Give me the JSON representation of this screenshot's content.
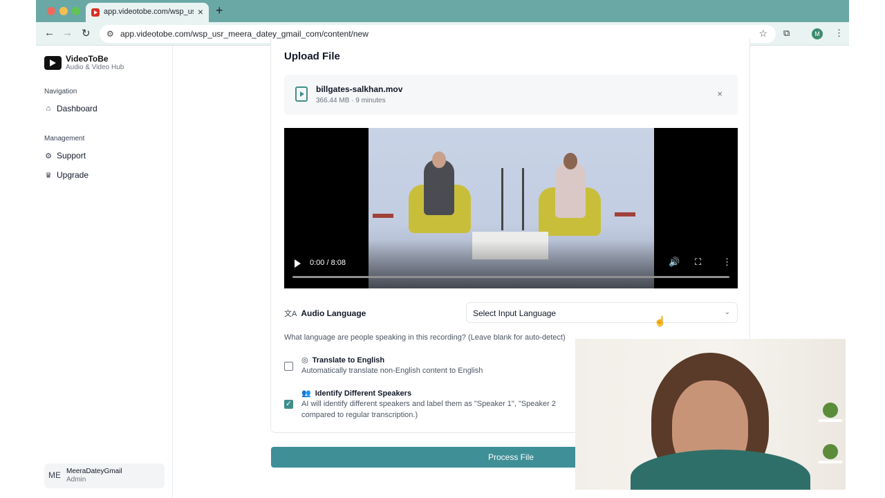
{
  "browser": {
    "tab_title": "app.videotobe.com/wsp_usr_",
    "tab_close": "×",
    "new_tab": "+",
    "url": "app.videotobe.com/wsp_usr_meera_datey_gmail_com/content/new",
    "profile_initial": "M"
  },
  "sidebar": {
    "brand": "VideoToBe",
    "tagline": "Audio & Video Hub",
    "sections": [
      {
        "title": "Navigation",
        "items": [
          {
            "label": "Dashboard",
            "icon": "home-icon"
          }
        ]
      },
      {
        "title": "Management",
        "items": [
          {
            "label": "Support",
            "icon": "gear-icon"
          },
          {
            "label": "Upgrade",
            "icon": "crown-icon"
          }
        ]
      }
    ],
    "user": {
      "initials": "ME",
      "name": "MeeraDateyGmail",
      "role": "Admin"
    }
  },
  "main": {
    "title": "Upload File",
    "file": {
      "name": "billgates-salkhan.mov",
      "meta": "366.44 MB  ·  9 minutes",
      "close": "×"
    },
    "video": {
      "timecode": "0:00 / 8:08",
      "progress": 0
    },
    "audio_language": {
      "label": "Audio Language",
      "select_value": "Select Input Language",
      "help": "What language are people speaking in this recording? (Leave blank for auto-detect)"
    },
    "options": [
      {
        "title": "Translate to English",
        "desc": "Automatically translate non-English content to English",
        "checked": false,
        "icon": "globe-icon"
      },
      {
        "title": "Identify Different Speakers",
        "desc1": "AI will identify different speakers and label them as \"Speaker 1\", \"Speaker 2",
        "desc2": "compared to regular transcription.)",
        "checked": true,
        "icon": "users-icon"
      }
    ],
    "process_button": "Process File"
  },
  "colors": {
    "accent": "#3f8f97",
    "tabstrip": "#6aa8a6"
  }
}
